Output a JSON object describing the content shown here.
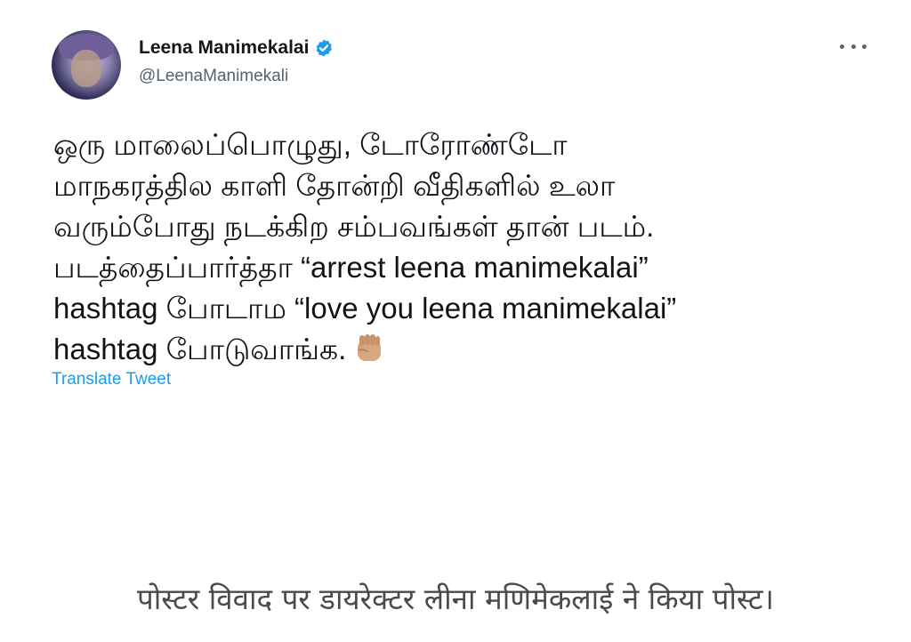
{
  "tweet": {
    "author_name": "Leena Manimekalai",
    "handle": "@LeenaManimekali",
    "verified": true,
    "verified_icon": "verified-badge-icon",
    "avatar": "avatar",
    "more_icon": "more-options-icon",
    "text_lines": [
      "ஒரு மாலைப்பொழுது, டோரோண்டோ",
      "மாநகரத்தில காளி தோன்றி வீதிகளில் உலா",
      "வரும்போது நடக்கிற சம்பவங்கள் தான் படம்.",
      "படத்தைப்பார்த்தா “arrest leena manimekalai”",
      "hashtag போடாம “love you leena manimekalai”",
      "hashtag போடுவாங்க."
    ],
    "emoji": "raised-fist-emoji",
    "translate_label": "Translate Tweet",
    "colors": {
      "link": "#1d9bf0",
      "verified": "#1d9bf0",
      "secondary_text": "#536471"
    }
  },
  "caption": "पोस्टर विवाद पर डायरेक्टर लीना मणिमेकलाई ने किया पोस्ट।"
}
